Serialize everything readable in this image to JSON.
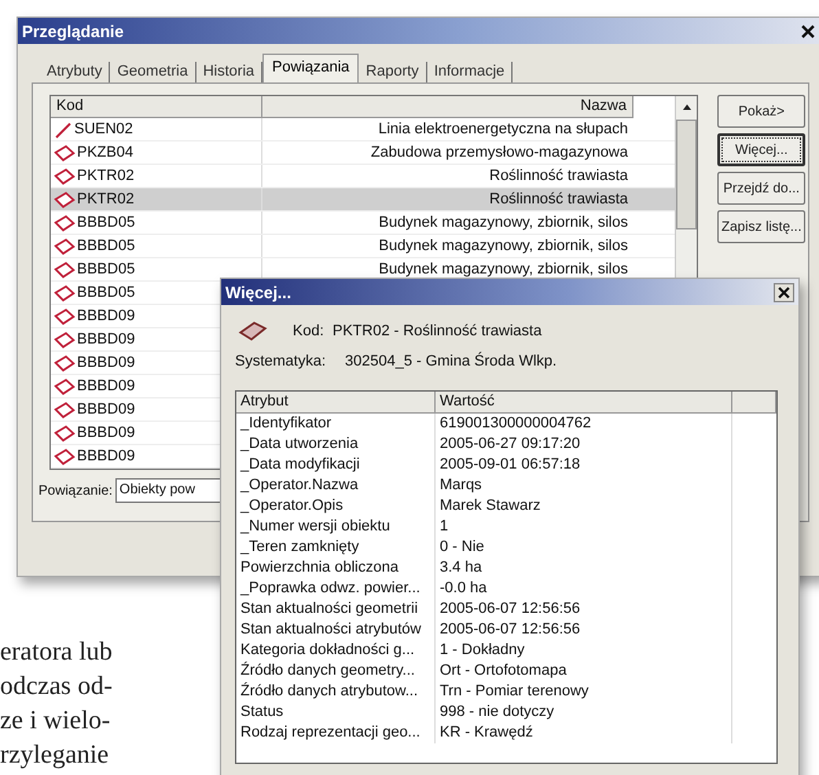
{
  "window": {
    "title": "Przeglądanie"
  },
  "tabs": [
    {
      "label": "Atrybuty",
      "selected": false
    },
    {
      "label": "Geometria",
      "selected": false
    },
    {
      "label": "Historia",
      "selected": false
    },
    {
      "label": "Powiązania",
      "selected": true
    },
    {
      "label": "Raporty",
      "selected": false
    },
    {
      "label": "Informacje",
      "selected": false
    }
  ],
  "list": {
    "columns": [
      "Kod",
      "Nazwa"
    ],
    "rows": [
      {
        "kind": "line",
        "code": "SUEN02",
        "name": "Linia elektroenergetyczna na słupach",
        "selected": false
      },
      {
        "kind": "polygon",
        "code": "PKZB04",
        "name": "Zabudowa przemysłowo-magazynowa",
        "selected": false
      },
      {
        "kind": "polygon",
        "code": "PKTR02",
        "name": "Roślinność trawiasta",
        "selected": false
      },
      {
        "kind": "polygon",
        "code": "PKTR02",
        "name": "Roślinność trawiasta",
        "selected": true
      },
      {
        "kind": "polygon",
        "code": "BBBD05",
        "name": "Budynek magazynowy, zbiornik, silos",
        "selected": false
      },
      {
        "kind": "polygon",
        "code": "BBBD05",
        "name": "Budynek magazynowy, zbiornik, silos",
        "selected": false
      },
      {
        "kind": "polygon",
        "code": "BBBD05",
        "name": "Budynek magazynowy, zbiornik, silos",
        "selected": false
      },
      {
        "kind": "polygon",
        "code": "BBBD05",
        "selected": false
      },
      {
        "kind": "polygon",
        "code": "BBBD09",
        "selected": false
      },
      {
        "kind": "polygon",
        "code": "BBBD09",
        "selected": false
      },
      {
        "kind": "polygon",
        "code": "BBBD09",
        "selected": false
      },
      {
        "kind": "polygon",
        "code": "BBBD09",
        "selected": false
      },
      {
        "kind": "polygon",
        "code": "BBBD09",
        "selected": false
      },
      {
        "kind": "polygon",
        "code": "BBBD09",
        "selected": false
      },
      {
        "kind": "polygon",
        "code": "BBBD09",
        "selected": false
      }
    ]
  },
  "buttons": [
    {
      "label": "Pokaż>",
      "focused": false
    },
    {
      "label": "Więcej...",
      "focused": true
    },
    {
      "label": "Przejdź do...",
      "focused": false
    },
    {
      "label": "Zapisz listę...",
      "focused": false
    }
  ],
  "relation": {
    "label": "Powiązanie:",
    "value": "Obiekty pow"
  },
  "dialog": {
    "title": "Więcej...",
    "kod_label": "Kod:",
    "kod_value": "PKTR02 - Roślinność trawiasta",
    "systematyka_label": "Systematyka:",
    "systematyka_value": "302504_5 - Gmina Środa Wlkp.",
    "columns": [
      "Atrybut",
      "Wartość"
    ],
    "rows": [
      {
        "attribute": "_Identyfikator",
        "value": "619001300000004762"
      },
      {
        "attribute": "_Data utworzenia",
        "value": "2005-06-27 09:17:20"
      },
      {
        "attribute": "_Data modyfikacji",
        "value": "2005-09-01 06:57:18"
      },
      {
        "attribute": "_Operator.Nazwa",
        "value": "Marqs"
      },
      {
        "attribute": "_Operator.Opis",
        "value": "Marek Stawarz"
      },
      {
        "attribute": "_Numer wersji obiektu",
        "value": "1"
      },
      {
        "attribute": "_Teren zamknięty",
        "value": "0 - Nie"
      },
      {
        "attribute": "Powierzchnia obliczona",
        "value": "3.4 ha"
      },
      {
        "attribute": "_Poprawka odwz. powier...",
        "value": "-0.0 ha"
      },
      {
        "attribute": "Stan aktualności geometrii",
        "value": "2005-06-07 12:56:56"
      },
      {
        "attribute": "Stan aktualności atrybutów",
        "value": "2005-06-07 12:56:56"
      },
      {
        "attribute": "Kategoria dokładności g...",
        "value": "1 - Dokładny"
      },
      {
        "attribute": "Źródło danych geometry...",
        "value": "Ort - Ortofotomapa"
      },
      {
        "attribute": "Źródło danych atrybutow...",
        "value": "Trn - Pomiar terenowy"
      },
      {
        "attribute": "Status",
        "value": "998 - nie dotyczy"
      },
      {
        "attribute": "Rodzaj reprezentacji geo...",
        "value": "KR - Krawędź"
      }
    ]
  },
  "page_text": [
    "eratora lub",
    "odczas od-",
    "ze i wielo-",
    "rzyleganie"
  ]
}
